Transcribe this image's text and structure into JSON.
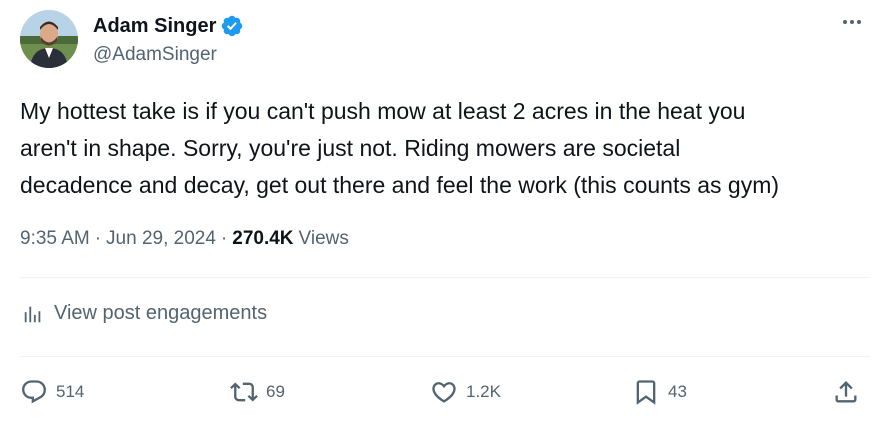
{
  "author": {
    "display_name": "Adam Singer",
    "handle": "@AdamSinger",
    "verified": true,
    "verified_color": "#1d9bf0"
  },
  "tweet": {
    "text": "My hottest take is if you can't push mow at least 2 acres in the heat you\naren't in shape. Sorry, you're just not. Riding mowers are societal\ndecadence and decay, get out there and feel the work (this counts as gym)"
  },
  "meta": {
    "time": "9:35 AM",
    "separator": "·",
    "date": "Jun 29, 2024",
    "views_count": "270.4K",
    "views_label": "Views"
  },
  "engagements": {
    "label": "View post engagements",
    "icon": "analytics-icon"
  },
  "actions": {
    "replies": {
      "icon": "reply-icon",
      "count": "514"
    },
    "reposts": {
      "icon": "repost-icon",
      "count": "69"
    },
    "likes": {
      "icon": "like-icon",
      "count": "1.2K"
    },
    "bookmarks": {
      "icon": "bookmark-icon",
      "count": "43"
    },
    "share": {
      "icon": "share-icon"
    }
  },
  "colors": {
    "text_primary": "#0f1419",
    "text_secondary": "#536471",
    "divider": "#eff3f4"
  }
}
